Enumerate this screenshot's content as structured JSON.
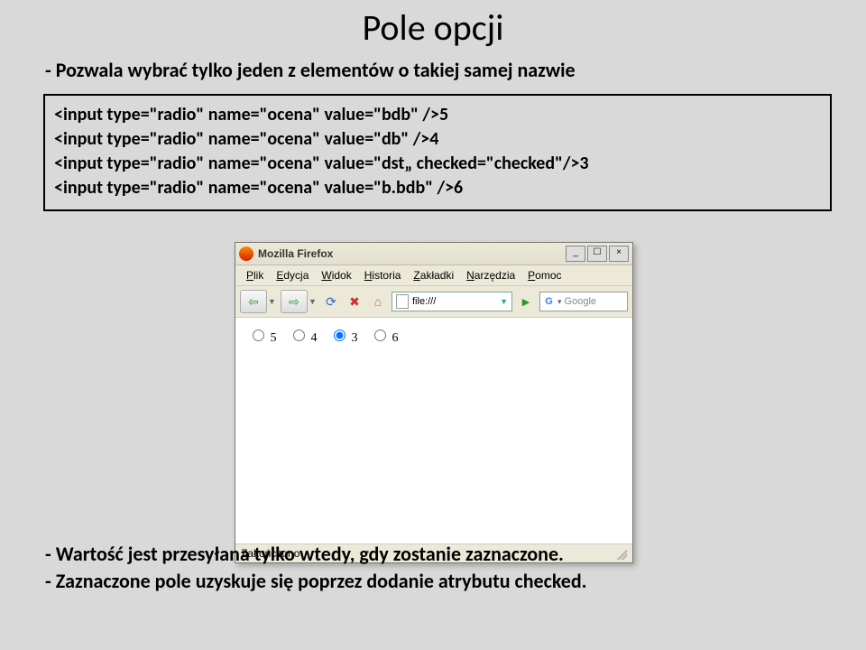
{
  "title": "Pole opcji",
  "bullets": {
    "intro": "- Pozwala wybrać tylko jeden z elementów o takiej samej nazwie",
    "note1": "- Wartość jest przesyłana tylko wtedy, gdy zostanie zaznaczone.",
    "note2": "- Zaznaczone pole uzyskuje się poprzez dodanie atrybutu checked."
  },
  "code": {
    "l1": "<input type=\"radio\" name=\"ocena\" value=\"bdb\" />5",
    "l2": "<input type=\"radio\" name=\"ocena\" value=\"db\" />4",
    "l3": "<input type=\"radio\" name=\"ocena\" value=\"dst„ checked=\"checked\"/>3",
    "l4": "<input type=\"radio\" name=\"ocena\" value=\"b.bdb\" />6"
  },
  "browser": {
    "appTitle": "Mozilla Firefox",
    "winbtns": {
      "min": "_",
      "max": "☐",
      "close": "×"
    },
    "menu": [
      "Plik",
      "Edycja",
      "Widok",
      "Historia",
      "Zakładki",
      "Narzędzia",
      "Pomoc"
    ],
    "toolbar": {
      "back": "⇦",
      "fwd": "⇨",
      "reload": "⟳",
      "stop": "✖",
      "home": "⌂",
      "url": "file:///",
      "searchPlaceholder": "Google",
      "go": "▶"
    },
    "content": {
      "radios": [
        {
          "label": "5",
          "checked": false
        },
        {
          "label": "4",
          "checked": false
        },
        {
          "label": "3",
          "checked": true
        },
        {
          "label": "6",
          "checked": false
        }
      ]
    },
    "status": "Zakończono"
  }
}
